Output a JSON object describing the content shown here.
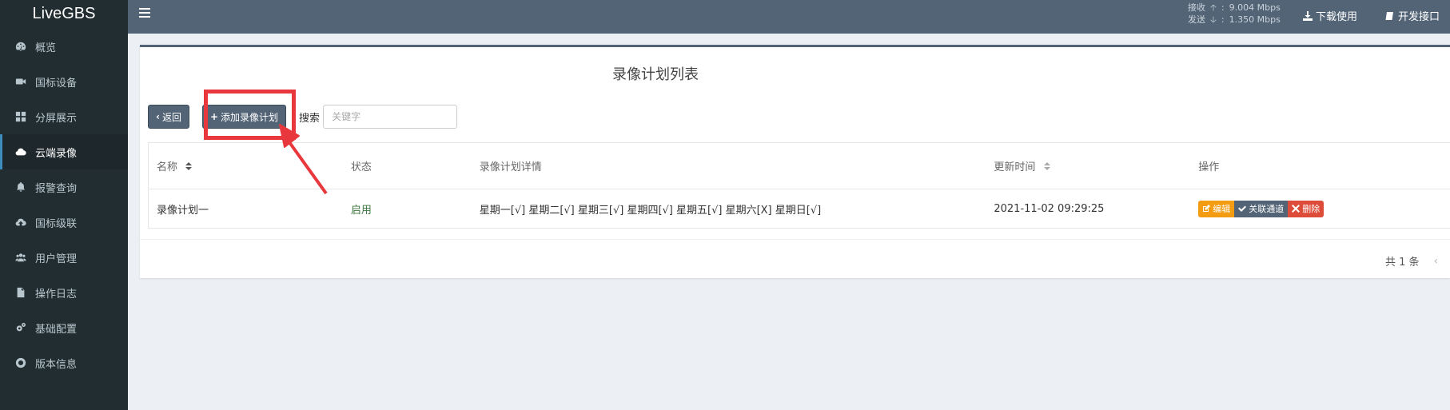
{
  "app": {
    "title": "LiveGBS"
  },
  "sidebar": {
    "items": [
      {
        "label": "概览",
        "icon": "dashboard-icon",
        "active": false
      },
      {
        "label": "国标设备",
        "icon": "video-camera-icon",
        "active": false
      },
      {
        "label": "分屏展示",
        "icon": "grid-icon",
        "active": false
      },
      {
        "label": "云端录像",
        "icon": "cloud-icon",
        "active": true
      },
      {
        "label": "报警查询",
        "icon": "bell-icon",
        "active": false
      },
      {
        "label": "国标级联",
        "icon": "cloud-upload-icon",
        "active": false
      },
      {
        "label": "用户管理",
        "icon": "users-icon",
        "active": false
      },
      {
        "label": "操作日志",
        "icon": "file-icon",
        "active": false
      },
      {
        "label": "基础配置",
        "icon": "cogs-icon",
        "active": false
      },
      {
        "label": "版本信息",
        "icon": "lifebuoy-icon",
        "active": false
      }
    ]
  },
  "header": {
    "recv_label": "接收",
    "recv_value": "9.004 Mbps",
    "send_label": "发送",
    "send_value": "1.350 Mbps",
    "colon": ":",
    "download_label": "下载使用",
    "dev_label": "开发接口"
  },
  "page": {
    "title": "录像计划列表",
    "back_label": "返回",
    "add_label": "添加录像计划",
    "search_label": "搜索",
    "search_placeholder": "关键字"
  },
  "table": {
    "headers": [
      "名称",
      "状态",
      "录像计划详情",
      "更新时间",
      "操作"
    ],
    "rows": [
      {
        "name": "录像计划一",
        "status": "启用",
        "detail": "星期一[√] 星期二[√] 星期三[√] 星期四[√] 星期五[√] 星期六[X] 星期日[√]",
        "updated": "2021-11-02 09:29:25",
        "actions": [
          "编辑",
          "关联通道",
          "删除"
        ]
      }
    ]
  },
  "pager": {
    "total_text": "共 1 条",
    "prev": "‹"
  },
  "colors": {
    "sidebar_bg": "#222d32",
    "header_bg": "#536476",
    "edit": "#f39c12",
    "delete": "#dd4b39",
    "highlight": "#e8383d",
    "status_on": "#3c763d"
  }
}
